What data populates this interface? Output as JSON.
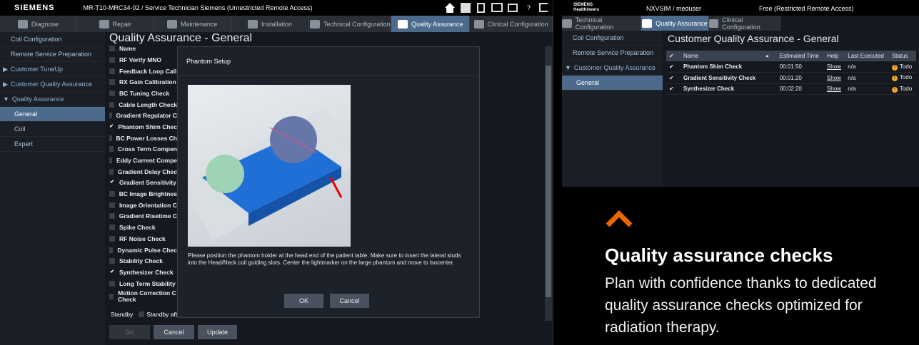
{
  "left": {
    "brand": "SIEMENS",
    "window_title": "MR-T10-MRC34-02 / Service Technician   Siemens (Unrestricted Remote Access)",
    "help": "?",
    "tabs": [
      "Diagnose",
      "Repair",
      "Maintenance",
      "Installation",
      "Technical Configuration",
      "Quality Assurance",
      "Clinical Configuration"
    ],
    "sidebar": [
      "Coil Configuration",
      "Remote Service Preparation",
      "Customer TuneUp",
      "Customer Quality Assurance",
      "Quality Assurance",
      "General",
      "Coil",
      "Expert"
    ],
    "page_title": "Quality Assurance - General",
    "list_header": "Name",
    "checks": [
      "RF Verify MNO",
      "Feedback Loop Cali",
      "RX Gain Calibration",
      "BC Tuning Check",
      "Cable Length Check",
      "Gradient Regulator C",
      "Phantom Shim Chec",
      "BC Power Losses Ch",
      "Cross Term Compen",
      "Eddy Current Compe",
      "Gradient Delay Chec",
      "Gradient Sensitivity",
      "BC Image Brightnes",
      "Image Orientation C",
      "Gradient Risetime C",
      "Spike Check",
      "RF Noise Check",
      "Dynamic Pulse Chec",
      "Stability Check",
      "Synthesizer Check",
      "Long Term Stability",
      "Motion Correction C Check"
    ],
    "checked_mark": "✔",
    "standby_label": "Standby",
    "standby_option": "Standby afte",
    "buttons": {
      "go": "Go",
      "cancel": "Cancel",
      "update": "Update"
    },
    "dialog": {
      "title": "Phantom Setup",
      "text": "Please position the phantom holder at the head end of the patient table. Make sure to insert the lateral studs into the Head/Neck coil guiding slots. Center the lightmarker on the large phantom and move to isocenter.",
      "ok": "OK",
      "cancel": "Cancel"
    }
  },
  "right": {
    "brand": "SIEMENS Healthineers",
    "user": "NXVSIM / meduser",
    "access": "Free (Restricted Remote Access)",
    "tabs": [
      "Technical Configuration",
      "Quality Assurance",
      "Clinical Configuration"
    ],
    "sidebar": [
      "Coil Configuration",
      "Remote Service Preparation",
      "Customer Quality Assurance",
      "General"
    ],
    "title": "Customer Quality Assurance - General",
    "columns": [
      "Name",
      "Estimated Time",
      "Help",
      "Last Executed",
      "Status"
    ],
    "rows": [
      {
        "check": "✔",
        "name": "Phantom Shim Check",
        "time": "00:01:50",
        "help": "Show",
        "last": "n/a",
        "status": "Todo"
      },
      {
        "check": "✔",
        "name": "Gradient Sensitivity Check",
        "time": "00:01:20",
        "help": "Show",
        "last": "n/a",
        "status": "Todo"
      },
      {
        "check": "✔",
        "name": "Synthesizer Check",
        "time": "00:02:20",
        "help": "Show",
        "last": "n/a",
        "status": "Todo"
      }
    ],
    "warn_glyph": "!"
  },
  "promo": {
    "heading": "Quality assurance checks",
    "body": "Plan with confidence thanks to dedicated quality assurance checks optimized for radiation therapy.",
    "accent": "#ec6602"
  }
}
